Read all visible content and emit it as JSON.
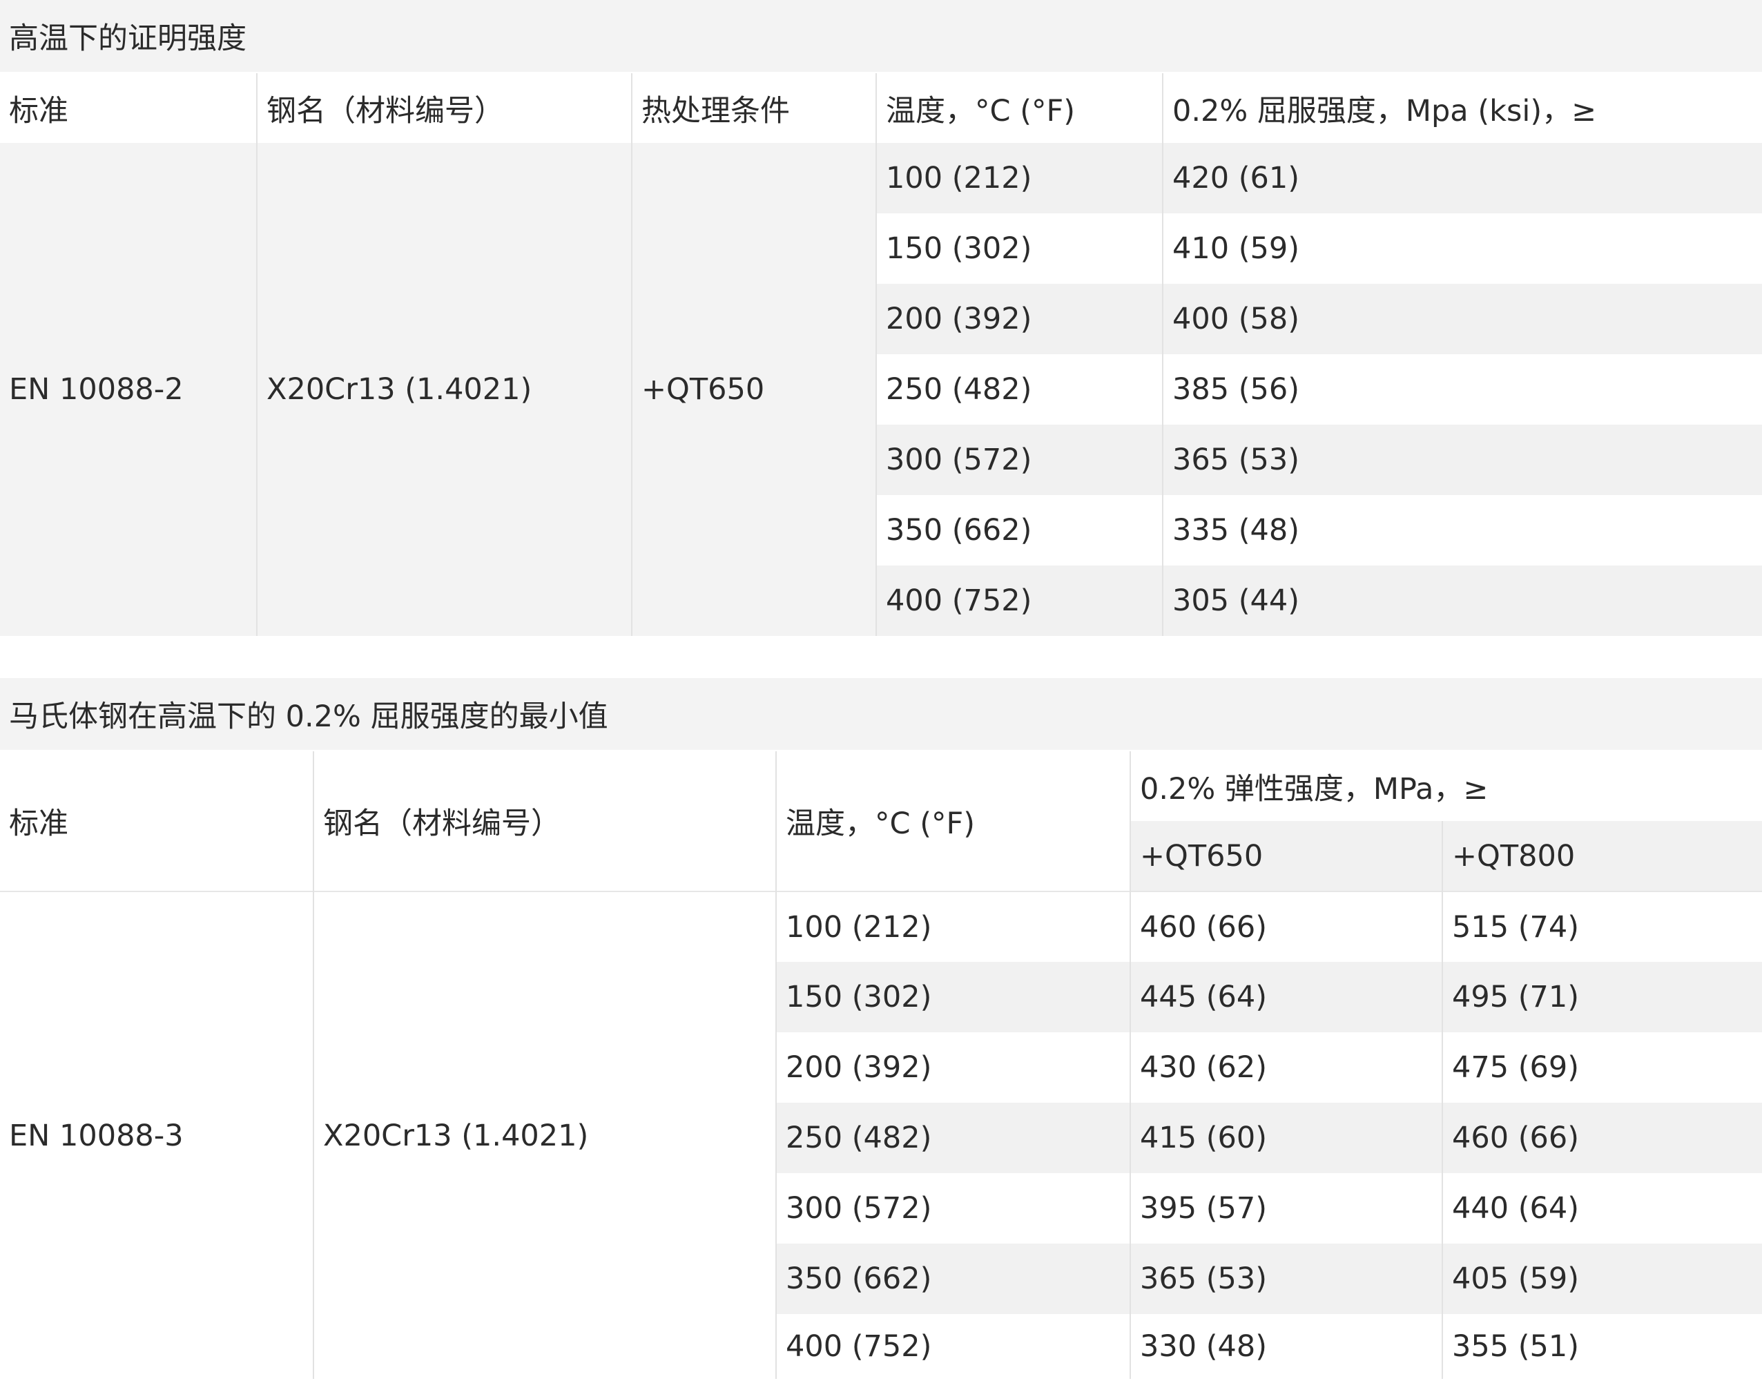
{
  "table1": {
    "title": "高温下的证明强度",
    "headers": {
      "standard": "标准",
      "steel_name": "钢名（材料编号）",
      "heat_treatment": "热处理条件",
      "temperature": "温度，°C (°F)",
      "proof_strength": "0.2% 屈服强度，Mpa (ksi)，≥"
    },
    "standard": "EN 10088-2",
    "steel_name": "X20Cr13 (1.4021)",
    "heat_treatment": "+QT650",
    "rows": [
      {
        "temperature": "100 (212)",
        "strength": "420 (61)"
      },
      {
        "temperature": "150 (302)",
        "strength": "410 (59)"
      },
      {
        "temperature": "200 (392)",
        "strength": "400 (58)"
      },
      {
        "temperature": "250 (482)",
        "strength": "385 (56)"
      },
      {
        "temperature": "300 (572)",
        "strength": "365 (53)"
      },
      {
        "temperature": "350 (662)",
        "strength": "335 (48)"
      },
      {
        "temperature": "400 (752)",
        "strength": "305 (44)"
      }
    ]
  },
  "table2": {
    "title": "马氏体钢在高温下的 0.2% 屈服强度的最小值",
    "headers": {
      "standard": "标准",
      "steel_name": "钢名（材料编号）",
      "temperature": "温度，°C (°F)",
      "elastic_strength": "0.2% 弹性强度，MPa，≥",
      "qt650": "+QT650",
      "qt800": "+QT800"
    },
    "standard": "EN 10088-3",
    "steel_name": "X20Cr13 (1.4021)",
    "rows": [
      {
        "temperature": "100 (212)",
        "qt650": "460 (66)",
        "qt800": "515 (74)"
      },
      {
        "temperature": "150 (302)",
        "qt650": "445 (64)",
        "qt800": "495 (71)"
      },
      {
        "temperature": "200 (392)",
        "qt650": "430 (62)",
        "qt800": "475 (69)"
      },
      {
        "temperature": "250 (482)",
        "qt650": "415 (60)",
        "qt800": "460 (66)"
      },
      {
        "temperature": "300 (572)",
        "qt650": "395 (57)",
        "qt800": "440 (64)"
      },
      {
        "temperature": "350 (662)",
        "qt650": "365 (53)",
        "qt800": "405 (59)"
      },
      {
        "temperature": "400 (752)",
        "qt650": "330 (48)",
        "qt800": "355 (51)"
      }
    ]
  }
}
